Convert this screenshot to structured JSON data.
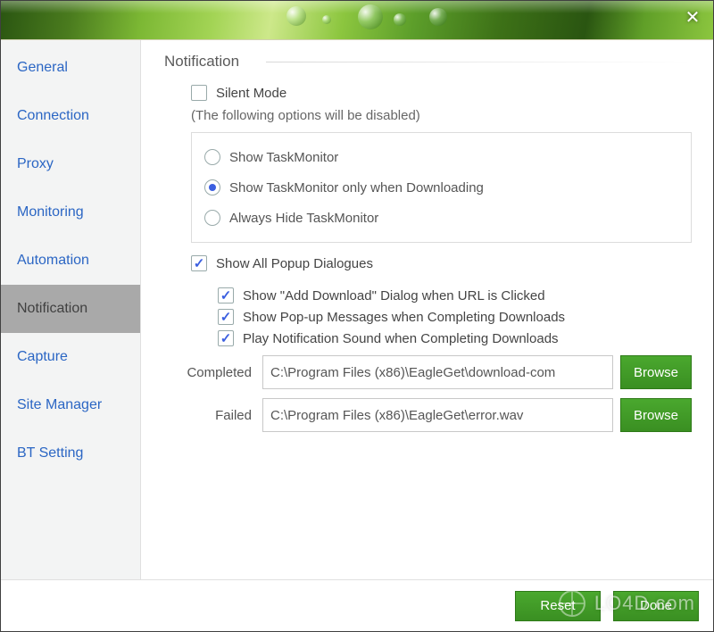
{
  "sidebar": {
    "items": [
      {
        "label": "General"
      },
      {
        "label": "Connection"
      },
      {
        "label": "Proxy"
      },
      {
        "label": "Monitoring"
      },
      {
        "label": "Automation"
      },
      {
        "label": "Notification"
      },
      {
        "label": "Capture"
      },
      {
        "label": "Site Manager"
      },
      {
        "label": "BT Setting"
      }
    ],
    "selected_index": 5
  },
  "section": {
    "title": "Notification"
  },
  "silent_mode": {
    "label": "Silent Mode",
    "checked": false,
    "note": "(The following options will be disabled)"
  },
  "taskmonitor_options": [
    {
      "label": "Show TaskMonitor",
      "checked": false
    },
    {
      "label": "Show TaskMonitor only when Downloading",
      "checked": true
    },
    {
      "label": "Always Hide TaskMonitor",
      "checked": false
    }
  ],
  "show_all_popups": {
    "label": "Show All Popup Dialogues",
    "checked": true,
    "children": [
      {
        "label": "Show \"Add Download\" Dialog when URL is Clicked",
        "checked": true
      },
      {
        "label": "Show Pop-up Messages when Completing Downloads",
        "checked": true
      },
      {
        "label": "Play Notification Sound when Completing Downloads",
        "checked": true
      }
    ]
  },
  "sounds": {
    "completed_label": "Completed",
    "completed_path": "C:\\Program Files (x86)\\EagleGet\\download-com",
    "failed_label": "Failed",
    "failed_path": "C:\\Program Files (x86)\\EagleGet\\error.wav"
  },
  "buttons": {
    "browse": "Browse",
    "reset": "Reset",
    "done": "Done"
  },
  "watermark": "LO4D.com"
}
